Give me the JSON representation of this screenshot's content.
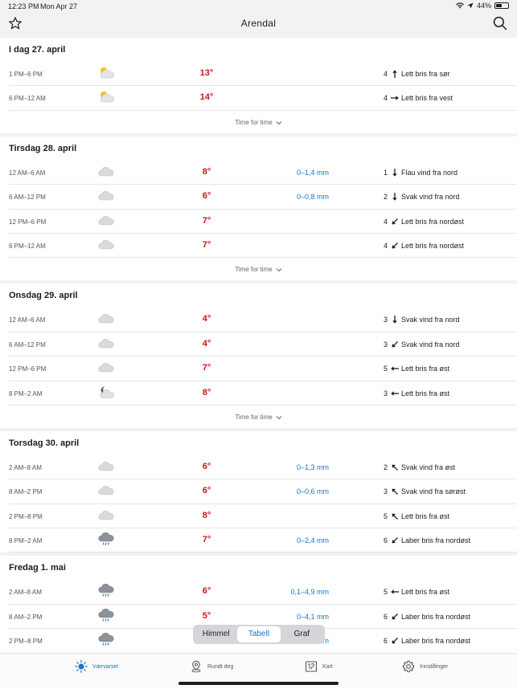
{
  "status": {
    "time": "12:23 PM",
    "date": "Mon Apr 27",
    "battery": "44%"
  },
  "header": {
    "title": "Arendal"
  },
  "days": [
    {
      "title": "I dag 27. april",
      "rows": [
        {
          "period": "1 PM–6 PM",
          "icon": "partly-cloudy-day",
          "temp": "13°",
          "precip": "",
          "wind_speed": "4",
          "wind_dir": "sør",
          "wind_desc": "Lett bris fra sør"
        },
        {
          "period": "6 PM–12 AM",
          "icon": "partly-cloudy-day",
          "temp": "14°",
          "precip": "",
          "wind_speed": "4",
          "wind_dir": "vest",
          "wind_desc": "Lett bris fra vest"
        }
      ],
      "more": "Time for time"
    },
    {
      "title": "Tirsdag 28. april",
      "rows": [
        {
          "period": "12 AM–6 AM",
          "icon": "cloudy",
          "temp": "8°",
          "precip": "0–1,4 mm",
          "wind_speed": "1",
          "wind_dir": "nord",
          "wind_desc": "Flau vind fra nord"
        },
        {
          "period": "6 AM–12 PM",
          "icon": "cloudy",
          "temp": "6°",
          "precip": "0–0,8 mm",
          "wind_speed": "2",
          "wind_dir": "nord",
          "wind_desc": "Svak vind fra nord"
        },
        {
          "period": "12 PM–6 PM",
          "icon": "cloudy",
          "temp": "7°",
          "precip": "",
          "wind_speed": "4",
          "wind_dir": "nordøst",
          "wind_desc": "Lett bris fra nordøst"
        },
        {
          "period": "6 PM–12 AM",
          "icon": "cloudy",
          "temp": "7°",
          "precip": "",
          "wind_speed": "4",
          "wind_dir": "nordøst",
          "wind_desc": "Lett bris fra nordøst"
        }
      ],
      "more": "Time for time"
    },
    {
      "title": "Onsdag 29. april",
      "rows": [
        {
          "period": "12 AM–6 AM",
          "icon": "cloudy",
          "temp": "4°",
          "precip": "",
          "wind_speed": "3",
          "wind_dir": "nord",
          "wind_desc": "Svak vind fra nord"
        },
        {
          "period": "6 AM–12 PM",
          "icon": "cloudy",
          "temp": "4°",
          "precip": "",
          "wind_speed": "3",
          "wind_dir": "nordøst",
          "wind_desc": "Svak vind fra nord"
        },
        {
          "period": "12 PM–6 PM",
          "icon": "cloudy",
          "temp": "7°",
          "precip": "",
          "wind_speed": "5",
          "wind_dir": "øst",
          "wind_desc": "Lett bris fra øst"
        },
        {
          "period": "8 PM–2 AM",
          "icon": "partly-cloudy-night",
          "temp": "8°",
          "precip": "",
          "wind_speed": "3",
          "wind_dir": "øst",
          "wind_desc": "Lett bris fra øst"
        }
      ],
      "more": "Time for time"
    },
    {
      "title": "Torsdag 30. april",
      "rows": [
        {
          "period": "2 AM–8 AM",
          "icon": "cloudy",
          "temp": "6°",
          "precip": "0–1,3 mm",
          "wind_speed": "2",
          "wind_dir": "sørøst",
          "wind_desc": "Svak vind fra øst"
        },
        {
          "period": "8 AM–2 PM",
          "icon": "cloudy",
          "temp": "6°",
          "precip": "0–0,6 mm",
          "wind_speed": "3",
          "wind_dir": "sørøst",
          "wind_desc": "Svak vind fra sørøst"
        },
        {
          "period": "2 PM–8 PM",
          "icon": "cloudy",
          "temp": "8°",
          "precip": "",
          "wind_speed": "5",
          "wind_dir": "sørøst",
          "wind_desc": "Lett bris fra øst"
        },
        {
          "period": "8 PM–2 AM",
          "icon": "rain",
          "temp": "7°",
          "precip": "0–2,4 mm",
          "wind_speed": "6",
          "wind_dir": "nordøst",
          "wind_desc": "Laber bris fra nordøst"
        }
      ],
      "more": ""
    },
    {
      "title": "Fredag 1. mai",
      "rows": [
        {
          "period": "2 AM–8 AM",
          "icon": "rain",
          "temp": "6°",
          "precip": "0,1–4,9 mm",
          "wind_speed": "5",
          "wind_dir": "øst",
          "wind_desc": "Lett bris fra øst"
        },
        {
          "period": "8 AM–2 PM",
          "icon": "rain",
          "temp": "5°",
          "precip": "0–4,1 mm",
          "wind_speed": "6",
          "wind_dir": "nordøst",
          "wind_desc": "Laber bris fra nordøst"
        },
        {
          "period": "2 PM–8 PM",
          "icon": "rain",
          "temp": "",
          "precip": "m",
          "wind_speed": "6",
          "wind_dir": "nordøst",
          "wind_desc": "Laber bris fra nordøst"
        }
      ],
      "more": ""
    }
  ],
  "view_toggle": {
    "options": [
      "Himmel",
      "Tabell",
      "Graf"
    ],
    "selected": "Tabell"
  },
  "tabs": [
    {
      "label": "Værvarsel",
      "icon": "sun-icon",
      "active": true
    },
    {
      "label": "Rundt deg",
      "icon": "location-pin-icon",
      "active": false
    },
    {
      "label": "Kart",
      "icon": "map-icon",
      "active": false
    },
    {
      "label": "Innstillinger",
      "icon": "gear-icon",
      "active": false
    }
  ],
  "colors": {
    "accent": "#1a73c7",
    "temp": "#c4161c"
  }
}
